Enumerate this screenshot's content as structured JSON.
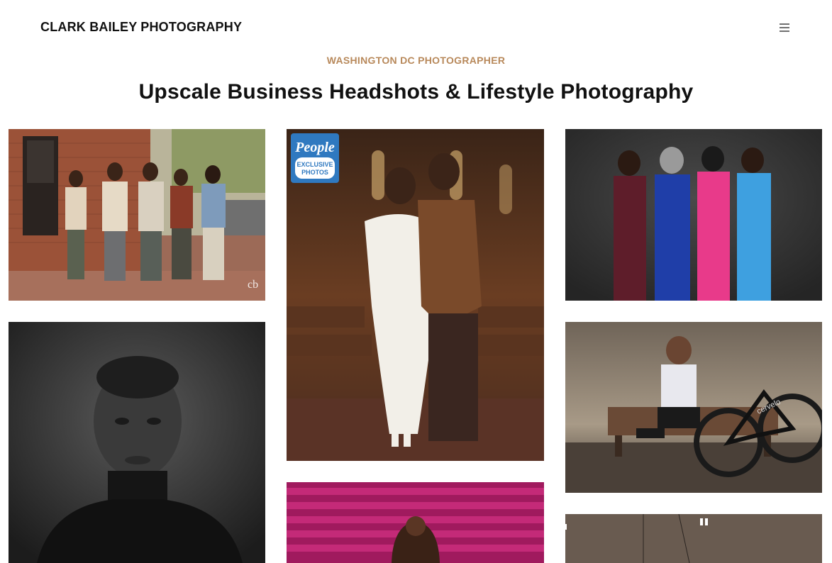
{
  "header": {
    "brand": "CLARK BAILEY PHOTOGRAPHY",
    "menu_icon": "hamburger-menu-icon"
  },
  "hero": {
    "eyebrow": "WASHINGTON DC PHOTOGRAPHER",
    "title": "Upscale Business Headshots & Lifestyle Photography"
  },
  "gallery": {
    "items": [
      {
        "name": "family-street-portrait",
        "watermark": "cb"
      },
      {
        "name": "maternity-church-portrait",
        "badge_line1": "People",
        "badge_line2": "EXCLUSIVE",
        "badge_line3": "PHOTOS"
      },
      {
        "name": "four-women-portrait"
      },
      {
        "name": "teen-bw-headshot"
      },
      {
        "name": "cyclist-bench-portrait",
        "bike_brand": "cervelo"
      },
      {
        "name": "pink-backdrop-portrait"
      },
      {
        "name": "studio-interior-photo"
      }
    ]
  },
  "colors": {
    "accent": "#b8895b",
    "text": "#111111",
    "background": "#ffffff"
  }
}
